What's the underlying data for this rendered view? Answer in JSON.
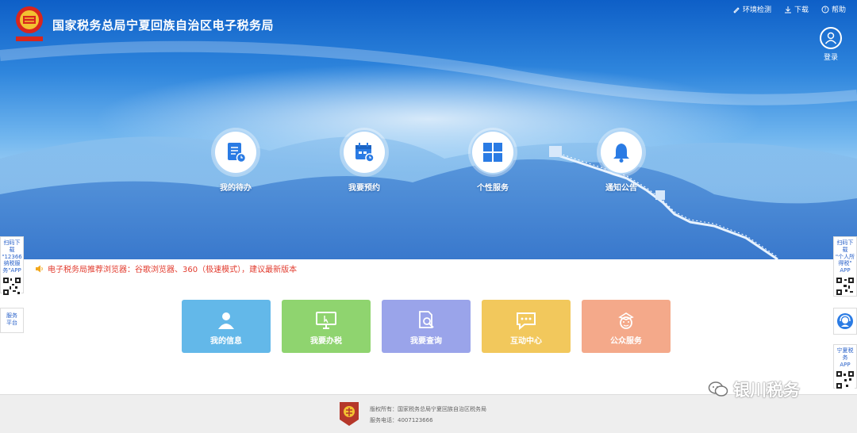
{
  "header": {
    "site_title": "国家税务总局宁夏回族自治区电子税务局",
    "links": [
      {
        "label": "环境检测",
        "icon": "brush-icon"
      },
      {
        "label": "下载",
        "icon": "download-icon"
      },
      {
        "label": "帮助",
        "icon": "help-icon"
      }
    ],
    "login_label": "登录"
  },
  "hero_menu": [
    {
      "label": "我的待办",
      "icon": "todo-icon"
    },
    {
      "label": "我要预约",
      "icon": "calendar-icon"
    },
    {
      "label": "个性服务",
      "icon": "grid-icon"
    },
    {
      "label": "通知公告",
      "icon": "bell-icon"
    }
  ],
  "notice": {
    "text": "电子税务局推荐浏览器：谷歌浏览器、360（极速模式），建议最新版本",
    "color": "#e23b2e"
  },
  "tiles": [
    {
      "label": "我的信息",
      "icon": "user-icon",
      "color": "#63b8e9"
    },
    {
      "label": "我要办税",
      "icon": "monitor-icon",
      "color": "#8fd46f"
    },
    {
      "label": "我要查询",
      "icon": "search-doc-icon",
      "color": "#9aa4ea"
    },
    {
      "label": "互动中心",
      "icon": "chat-icon",
      "color": "#f2c85c"
    },
    {
      "label": "公众服务",
      "icon": "mascot-icon",
      "color": "#f4a98a"
    }
  ],
  "side_left": {
    "app_text": [
      "扫码下载",
      "\"12366",
      "纳税服",
      "务\"APP"
    ],
    "service_text": [
      "服务",
      "平台"
    ]
  },
  "side_right": {
    "app1_text": [
      "扫码下载",
      "\"个人所",
      "得税\"",
      "APP"
    ],
    "app2_text": [
      "宁夏税务",
      "APP"
    ]
  },
  "footer": {
    "copyright": "版权所有：国家税务总局宁夏回族自治区税务局",
    "phone": "服务电话：4007123666"
  },
  "watermark": "银川税务",
  "colors": {
    "accent": "#2a7be4",
    "hero_top": "#0e5fc7",
    "footer_bg": "#eeeeee"
  }
}
